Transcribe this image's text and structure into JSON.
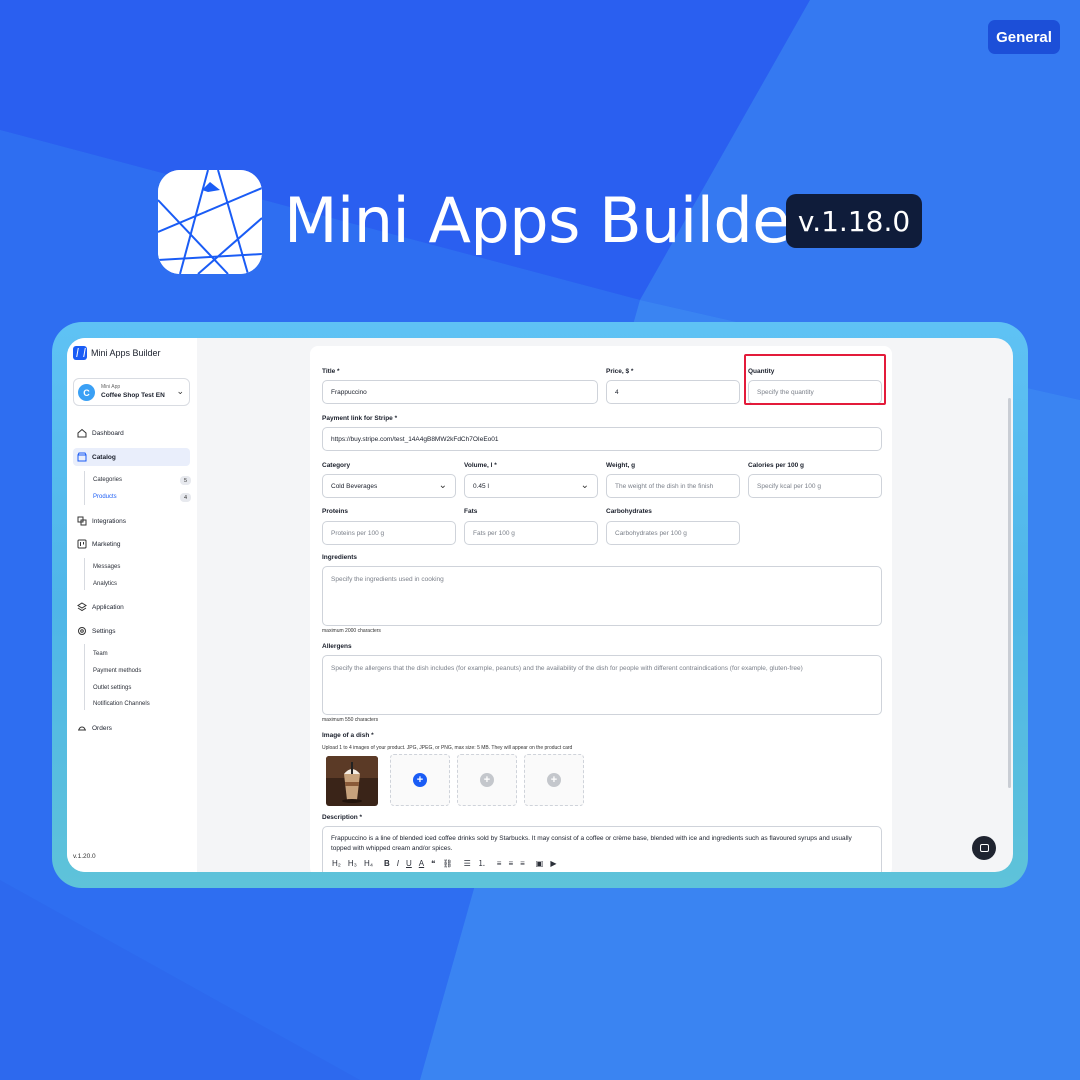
{
  "colors": {
    "accent": "#1a5cf5",
    "background": "#2f6ff0",
    "highlight": "#e31b3a",
    "frame": "#5fc2f4"
  },
  "badge": {
    "label": "General"
  },
  "hero": {
    "title": "Mini Apps Builder",
    "version": "v.1.18.0"
  },
  "sidebar": {
    "brand": "Mini Apps Builder",
    "app_kicker": "Mini App",
    "app_name": "Coffee Shop Test EN",
    "app_avatar": "C",
    "nav": {
      "dashboard": "Dashboard",
      "catalog": "Catalog",
      "categories": "Categories",
      "categories_count": "5",
      "products": "Products",
      "products_count": "4",
      "integrations": "Integrations",
      "marketing": "Marketing",
      "messages": "Messages",
      "analytics": "Analytics",
      "application": "Application",
      "settings": "Settings",
      "team": "Team",
      "payment_methods": "Payment methods",
      "outlet_settings": "Outlet settings",
      "notification_channels": "Notification Channels",
      "orders": "Orders"
    },
    "version": "v.1.20.0"
  },
  "form": {
    "title_label": "Title  *",
    "title_value": "Frappuccino",
    "price_label": "Price, $  *",
    "price_value": "4",
    "quantity_label": "Quantity",
    "quantity_placeholder": "Specify the quantity",
    "stripe_label": "Payment link for Stripe  *",
    "stripe_value": "https://buy.stripe.com/test_14A4gB8MW2kFdCh7OIeEo01",
    "category_label": "Category",
    "category_value": "Cold Beverages",
    "volume_label": "Volume, l  *",
    "volume_value": "0.45 l",
    "weight_label": "Weight, g",
    "weight_placeholder": "The weight of the dish in the finish",
    "calories_label": "Calories per 100 g",
    "calories_placeholder": "Specify kcal per 100 g",
    "proteins_label": "Proteins",
    "proteins_placeholder": "Proteins per 100 g",
    "fats_label": "Fats",
    "fats_placeholder": "Fats per 100 g",
    "carbs_label": "Carbohydrates",
    "carbs_placeholder": "Carbohydrates per 100 g",
    "ingredients_label": "Ingredients",
    "ingredients_placeholder": "Specify the ingredients used in cooking",
    "ingredients_hint": "maximum 2000 characters",
    "allergens_label": "Allergens",
    "allergens_placeholder": "Specify the allergens that the dish includes (for example, peanuts) and the availability of the dish for people with different contraindications (for example, gluten-free)",
    "allergens_hint": "maximum 550 characters",
    "image_label": "Image of a dish  *",
    "image_hint": "Upload 1 to 4 images of your product. JPG, JPEG, or PNG, max size: 5 MB. They will appear on the product card",
    "description_label": "Description  *",
    "description_value": "Frappuccino is a line of blended iced coffee drinks sold by Starbucks. It may consist of a coffee or crème base, blended with ice and ingredients such as flavoured syrups and usually topped with whipped cream and/or spices.",
    "toolbar": {
      "h2": "H₂",
      "h3": "H₃",
      "h4": "H₄",
      "bold": "B",
      "italic": "I",
      "underline": "U",
      "color": "A",
      "quote": "❝",
      "link": "⛓",
      "bullets": "☰",
      "numbers": "⒈",
      "align_left": "≡",
      "align_center": "≡",
      "align_right": "≡",
      "image": "▣",
      "video": "▶"
    }
  }
}
